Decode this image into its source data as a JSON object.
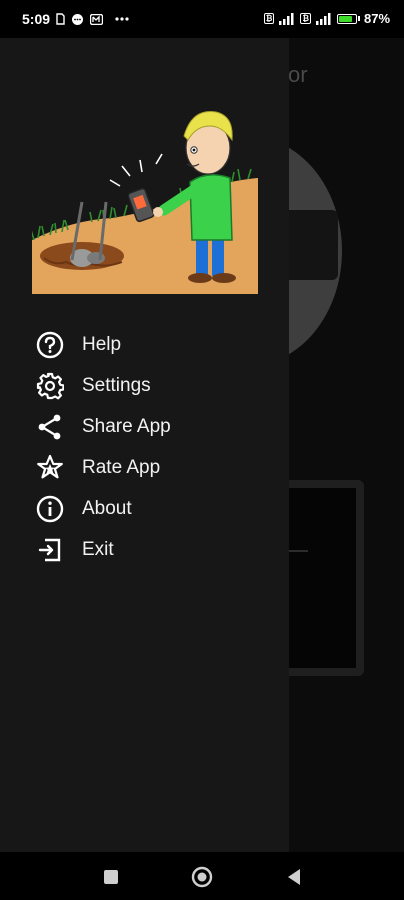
{
  "status_bar": {
    "time": "5:09",
    "battery_percent": "87",
    "battery_level": 0.87,
    "icons": [
      "sim-icon",
      "message-icon",
      "app-icon",
      "more-dots-icon",
      "wifi-signal-badge-icon",
      "signal-icon",
      "signal-icon",
      "battery-icon"
    ]
  },
  "background_app": {
    "title_fragment": "or"
  },
  "drawer": {
    "header_image": "metal-detector-cartoon",
    "menu": [
      {
        "label": "Help",
        "icon": "help-icon"
      },
      {
        "label": "Settings",
        "icon": "gear-icon"
      },
      {
        "label": "Share App",
        "icon": "share-icon"
      },
      {
        "label": "Rate App",
        "icon": "star-icon"
      },
      {
        "label": "About",
        "icon": "info-icon"
      },
      {
        "label": "Exit",
        "icon": "exit-icon"
      }
    ]
  },
  "nav_bar": {
    "buttons": [
      "recent-apps-icon",
      "home-icon",
      "back-icon"
    ]
  },
  "colors": {
    "drawer_bg": "#171717",
    "battery_green": "#3ddc2b",
    "text": "#f2f2f2"
  }
}
